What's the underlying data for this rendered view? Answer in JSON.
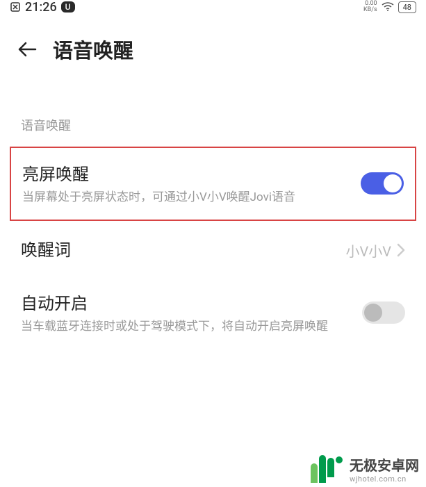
{
  "status_bar": {
    "time": "21:26",
    "badge": "U",
    "net_speed_value": "0.00",
    "net_speed_unit": "KB/s",
    "battery": "48"
  },
  "header": {
    "title": "语音唤醒"
  },
  "section": {
    "label": "语音唤醒"
  },
  "items": {
    "screen_on_wake": {
      "title": "亮屏唤醒",
      "subtitle": "当屏幕处于亮屏状态时，可通过小V小V唤醒Jovi语音"
    },
    "wake_word": {
      "title": "唤醒词",
      "value": "小V小V"
    },
    "auto_enable": {
      "title": "自动开启",
      "subtitle": "当车载蓝牙连接时或处于驾驶模式下，将自动开启亮屏唤醒"
    }
  },
  "watermark": {
    "cn": "无极安卓网",
    "en": "wjhotel.com.cn"
  }
}
